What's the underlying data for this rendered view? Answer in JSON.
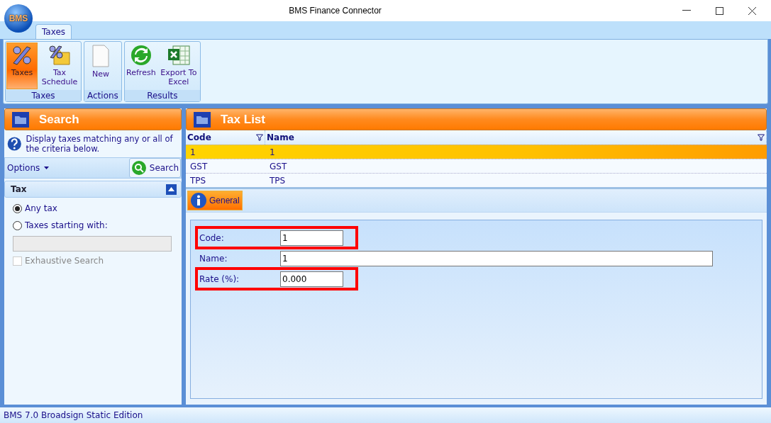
{
  "window": {
    "title": "BMS Finance Connector",
    "logo": "BMS"
  },
  "ribbon_tabs": [
    {
      "label": "Taxes",
      "selected": true
    }
  ],
  "ribbon_groups": [
    {
      "label": "Taxes",
      "buttons": [
        {
          "label": "Taxes",
          "selected": true
        },
        {
          "label": "Tax Schedule",
          "selected": false
        }
      ]
    },
    {
      "label": "Actions",
      "buttons": [
        {
          "label": "New",
          "selected": false
        }
      ]
    },
    {
      "label": "Results",
      "buttons": [
        {
          "label": "Refresh",
          "selected": false
        },
        {
          "label": "Export To Excel",
          "selected": false
        }
      ]
    }
  ],
  "search_panel": {
    "title": "Search",
    "help": "Display taxes matching any or all of the criteria below.",
    "options_label": "Options",
    "search_button": "Search",
    "section": {
      "title": "Tax",
      "expanded": true
    },
    "options": [
      {
        "kind": "radio",
        "label": "Any tax",
        "checked": true
      },
      {
        "kind": "radio",
        "label": "Taxes starting with:",
        "checked": false
      },
      {
        "kind": "input",
        "disabled": true
      },
      {
        "kind": "checkbox",
        "label": "Exhaustive Search",
        "checked": false,
        "disabled": true
      }
    ]
  },
  "tax_list": {
    "title": "Tax List",
    "columns": [
      "Code",
      "Name"
    ],
    "rows": [
      {
        "cells": [
          "1",
          "1"
        ],
        "selected": true
      },
      {
        "cells": [
          "GST",
          "GST"
        ],
        "selected": false
      },
      {
        "cells": [
          "TPS",
          "TPS"
        ],
        "selected": false
      }
    ]
  },
  "detail_tabs": [
    {
      "label": "General",
      "selected": true
    }
  ],
  "fields": [
    {
      "label": "Code:",
      "value": "1",
      "wide": false,
      "highlighted": true
    },
    {
      "label": "Name:",
      "value": "1",
      "wide": true,
      "highlighted": false
    },
    {
      "label": "Rate (%):",
      "value": "0.000",
      "wide": false,
      "highlighted": true
    }
  ],
  "status_bar": "BMS 7.0 Broadsign Static Edition"
}
